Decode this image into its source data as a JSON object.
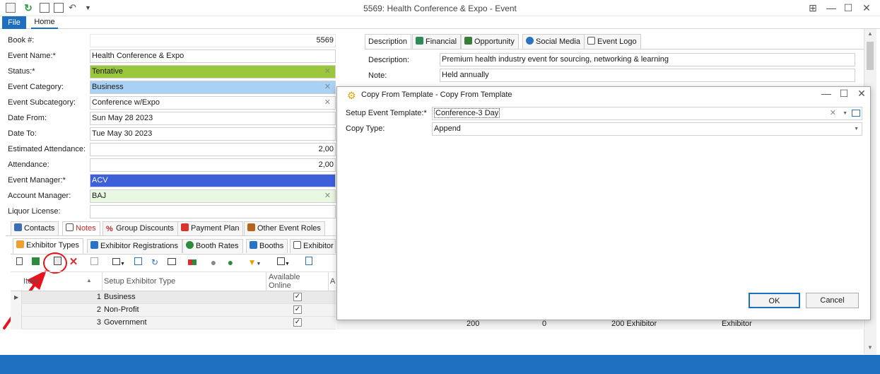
{
  "window": {
    "title": "5569: Health Conference & Expo - Event",
    "controls": [
      "restore-icon",
      "minimize-icon",
      "maximize-icon",
      "close-icon"
    ]
  },
  "ribbon": {
    "file_label": "File",
    "home_label": "Home"
  },
  "form": {
    "book_label": "Book #:",
    "book_value": "5569",
    "event_name_label": "Event Name:*",
    "event_name_value": "Health Conference & Expo",
    "status_label": "Status:*",
    "status_value": "Tentative",
    "category_label": "Event Category:",
    "category_value": "Business",
    "subcategory_label": "Event Subcategory:",
    "subcategory_value": "Conference w/Expo",
    "date_from_label": "Date From:",
    "date_from_value": "Sun May 28 2023",
    "date_to_label": "Date To:",
    "date_to_value": "Tue May 30 2023",
    "est_attendance_label": "Estimated Attendance:",
    "est_attendance_value": "2,00",
    "attendance_label": "Attendance:",
    "attendance_value": "2,00",
    "event_manager_label": "Event Manager:*",
    "event_manager_value": "ACV",
    "account_manager_label": "Account Manager:",
    "account_manager_value": "BAJ",
    "liquor_label": "Liquor License:",
    "liquor_value": ""
  },
  "right_panel": {
    "tabs": [
      "Description",
      "Financial",
      "Opportunity",
      "Social Media",
      "Event Logo"
    ],
    "description_label": "Description:",
    "description_value": "Premium health industry event for sourcing, networking & learning",
    "note_label": "Note:",
    "note_value": "Held annually"
  },
  "bottom_tabs": [
    "Contacts",
    "Notes",
    "Group Discounts",
    "Payment Plan",
    "Other Event Roles"
  ],
  "sub_tabs": [
    "Exhibitor Types",
    "Exhibitor Registrations",
    "Booth Rates",
    "Booths",
    "Exhibitor"
  ],
  "grid": {
    "headers": [
      "Item",
      "Setup Exhibitor Type",
      "Available Online",
      "A"
    ],
    "rows": [
      {
        "num": "1",
        "type": "Business",
        "online": true
      },
      {
        "num": "2",
        "type": "Non-Profit",
        "online": true
      },
      {
        "num": "3",
        "type": "Government",
        "online": true
      }
    ],
    "hidden_row_values": [
      "200",
      "0",
      "200 Exhibitor",
      "Exhibitor"
    ]
  },
  "dialog": {
    "title": "Copy From Template - Copy From Template",
    "template_label": "Setup Event Template:*",
    "template_value": "Conference-3 Day",
    "copy_type_label": "Copy Type:",
    "copy_type_value": "Append",
    "ok_label": "OK",
    "cancel_label": "Cancel"
  },
  "colors": {
    "accent": "#1e6fc0",
    "status_tentative": "#9bc73a",
    "category_business": "#a9d1f5",
    "manager": "#3d5fd9",
    "annotation": "#e8141d"
  }
}
